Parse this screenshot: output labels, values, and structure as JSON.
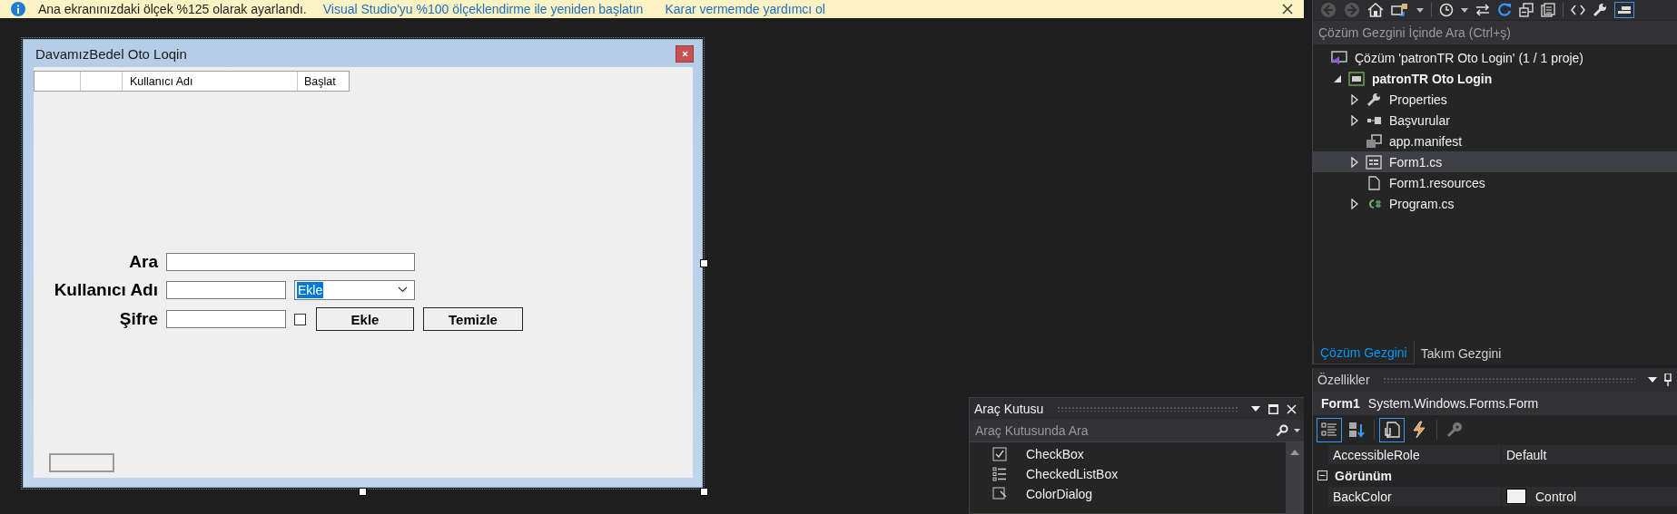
{
  "info_bar": {
    "message": "Ana ekranınızdaki ölçek %125 olarak ayarlandı.",
    "links": [
      "Visual Studio'yu %100 ölçeklendirme ile yeniden başlatın",
      "Karar vermemde yardımcı ol"
    ]
  },
  "form": {
    "title": "DavamızBedel Oto Loqin",
    "grid_columns": [
      "Kullanıcı Adı",
      "Başlat"
    ],
    "fields": [
      {
        "kind": "search",
        "label": "Ara"
      },
      {
        "kind": "user",
        "label": "Kullanıcı Adı",
        "combo": {
          "value": "Ekle",
          "highlighted": true
        }
      },
      {
        "kind": "password",
        "label": "Şifre",
        "checkbox": {
          "checked": false
        },
        "buttons": [
          "Ekle",
          "Temizle"
        ]
      }
    ]
  },
  "toolbox": {
    "title": "Araç Kutusu",
    "search_placeholder": "Araç Kutusunda Ara",
    "items": [
      {
        "kind": "checkbox",
        "label": "CheckBox"
      },
      {
        "kind": "checkedlist",
        "label": "CheckedListBox"
      },
      {
        "kind": "colordialog",
        "label": "ColorDialog"
      }
    ]
  },
  "solution_explorer": {
    "search_placeholder": "Çözüm Gezgini İçinde Ara (Ctrl+ş)",
    "tree": [
      {
        "kind": "solution",
        "label": "Çözüm 'patronTR Oto Login' (1 / 1 proje)",
        "expandable": false,
        "selected": false,
        "children": [
          {
            "kind": "project",
            "label": "patronTR Oto Login",
            "expandable": true,
            "expanded": true,
            "selected": false,
            "children": [
              {
                "kind": "wrench",
                "label": "Properties",
                "expandable": true,
                "expanded": false,
                "selected": false
              },
              {
                "kind": "references",
                "label": "Başvurular",
                "expandable": true,
                "expanded": false,
                "selected": false
              },
              {
                "kind": "manifest",
                "label": "app.manifest",
                "expandable": false,
                "selected": false
              },
              {
                "kind": "form",
                "label": "Form1.cs",
                "expandable": true,
                "expanded": false,
                "selected": true
              },
              {
                "kind": "file",
                "label": "Form1.resources",
                "expandable": false,
                "selected": false
              },
              {
                "kind": "csharp",
                "label": "Program.cs",
                "expandable": true,
                "expanded": false,
                "selected": false
              }
            ]
          }
        ]
      }
    ]
  },
  "tabs": [
    {
      "label": "Çözüm Gezgini",
      "selected": true
    },
    {
      "label": "Takım Gezgini",
      "selected": false
    }
  ],
  "properties": {
    "title": "Özellikler",
    "object_name": "Form1",
    "object_type": "System.Windows.Forms.Form",
    "tools": [
      {
        "kind": "categorized",
        "selected": true
      },
      {
        "kind": "alphabetical",
        "selected": false
      },
      {
        "kind": "properties",
        "selected": true
      },
      {
        "kind": "events",
        "selected": false
      },
      {
        "kind": "pages",
        "selected": false
      }
    ],
    "rows": [
      {
        "kind": "property",
        "name": "AccessibleRole",
        "value": "Default"
      },
      {
        "kind": "category",
        "name": "Görünüm",
        "expanded": true
      },
      {
        "kind": "property",
        "name": "BackColor",
        "value": "Control",
        "color": "#f0f0f0"
      }
    ]
  }
}
